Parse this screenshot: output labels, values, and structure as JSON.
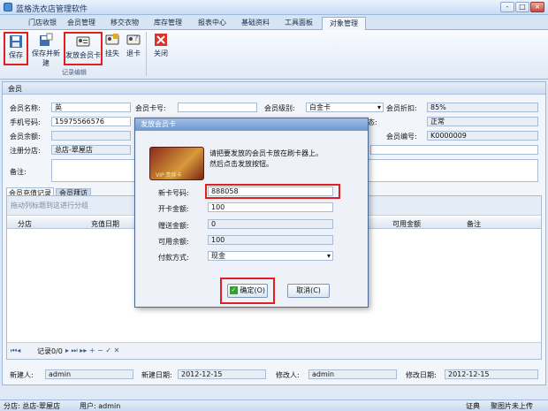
{
  "window": {
    "title": "蓝格洗衣店管理软件",
    "controls": [
      "-",
      "□",
      "×"
    ]
  },
  "tabs": [
    "门店收银",
    "会员管理",
    "移交衣物",
    "库存管理",
    "报表中心",
    "基础资料",
    "工具面板",
    "对象管理"
  ],
  "ribbon": {
    "buttons": [
      "保存",
      "保存并新建",
      "发放会员卡",
      "挂失",
      "退卡",
      "关闭"
    ],
    "group": "记录编辑"
  },
  "panel_title": "会员",
  "form": {
    "name_label": "会员名称:",
    "name": "英",
    "card_label": "会员卡号:",
    "card": "",
    "level_label": "会员级别:",
    "level": "白金卡",
    "discount_label": "会员折扣:",
    "discount": "85%",
    "phone_label": "手机号码:",
    "phone": "15975566576",
    "status_label": "状态:",
    "status": "正常",
    "balance_label": "会员余额:",
    "balance": "",
    "number_label": "会员编号:",
    "number": "K0000009",
    "shop_label": "注册分店:",
    "shop": "总店-翠屋店",
    "remark_label": "备注:",
    "remark": ""
  },
  "subtabs": [
    "会员充值记录",
    "会员拜访"
  ],
  "grid": {
    "drag_hint": "拖动列标题到这进行分组",
    "columns": [
      "分店",
      "充值日期",
      "可用金额",
      "备注"
    ],
    "nav": "记录0/0"
  },
  "footer": {
    "creator_label": "新建人:",
    "creator": "admin",
    "created_label": "新建日期:",
    "created": "2012-12-15",
    "modifier_label": "修改人:",
    "modifier": "admin",
    "modified_label": "修改日期:",
    "modified": "2012-12-15"
  },
  "statusbar": {
    "shop": "分店: 总店-翠屋店",
    "user": "用户: admin",
    "right1": "证典",
    "right2": "聚图片未上传"
  },
  "dialog": {
    "title": "发放会员卡",
    "card_text": "VIP 贵宾卡",
    "message_line1": "请把要发放的会员卡放在刷卡器上。",
    "message_line2": "然后点击发放按钮。",
    "new_card_label": "新卡号码:",
    "new_card": "888058",
    "open_amount_label": "开卡金额:",
    "open_amount": "100",
    "gift_label": "赠送金额:",
    "gift": "0",
    "available_label": "可用余额:",
    "available": "100",
    "pay_label": "付款方式:",
    "pay": "现金",
    "ok": "确定(O)",
    "cancel": "取消(C)"
  }
}
